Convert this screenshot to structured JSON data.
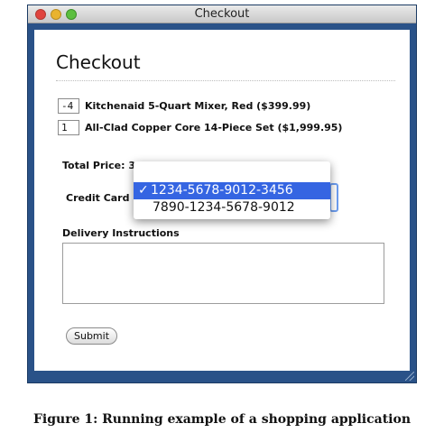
{
  "window": {
    "title": "Checkout"
  },
  "page": {
    "heading": "Checkout"
  },
  "items": [
    {
      "qty": "-4",
      "label": "Kitchenaid 5-Quart Mixer, Red ($399.99)"
    },
    {
      "qty": "1",
      "label": "All-Clad Copper Core 14-Piece Set ($1,999.95)"
    }
  ],
  "total": {
    "label": "Total Price: 399.95"
  },
  "credit_card": {
    "label": "Credit Card :",
    "options": [
      {
        "text": "1234-5678-9012-3456",
        "selected": true
      },
      {
        "text": "7890-1234-5678-9012",
        "selected": false
      }
    ],
    "check_glyph": "✓"
  },
  "delivery": {
    "label": "Delivery Instructions",
    "value": ""
  },
  "submit": {
    "label": "Submit"
  },
  "caption": "Figure 1: Running example of a shopping application",
  "colors": {
    "window_frame": "#2a5288",
    "selection": "#3565e2"
  }
}
